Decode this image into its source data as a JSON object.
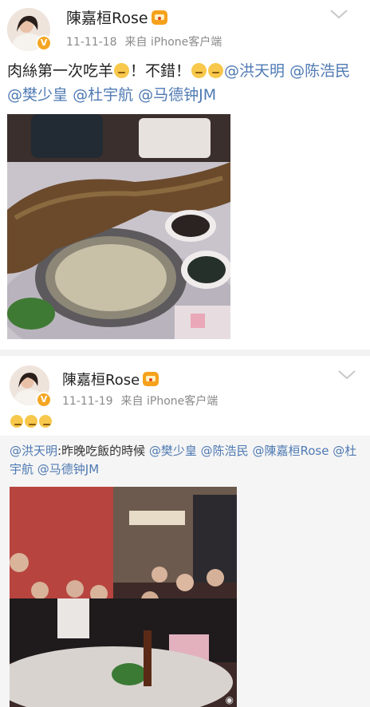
{
  "post1": {
    "author": "陳嘉桓Rose",
    "time": "11-11-18",
    "source": "来自 iPhone客户端",
    "text_parts": [
      "肉絲第一次吃羊",
      "！不錯！",
      "@洪天明",
      "@陈浩民",
      "@樊少皇",
      "@杜宇航",
      "@马德钟JM"
    ]
  },
  "post2": {
    "author": "陳嘉桓Rose",
    "time": "11-11-19",
    "source": "来自 iPhone客户端",
    "repost": {
      "mention_author": "@洪天明",
      "text": ":昨晚吃飯的時候",
      "mentions": [
        "@樊少皇",
        "@陈浩民",
        "@陳嘉桓Rose",
        "@杜宇航",
        "@马德钟JM"
      ]
    }
  },
  "icons": {
    "verified": "verified-badge-icon",
    "crown": "crown-emoji-icon",
    "chevron": "chevron-down-icon",
    "emoji": "smirk-emoji-icon"
  },
  "colors": {
    "mention": "#4f7ab3",
    "meta": "#8a8a8a",
    "repost_bg": "#f5f5f5"
  }
}
